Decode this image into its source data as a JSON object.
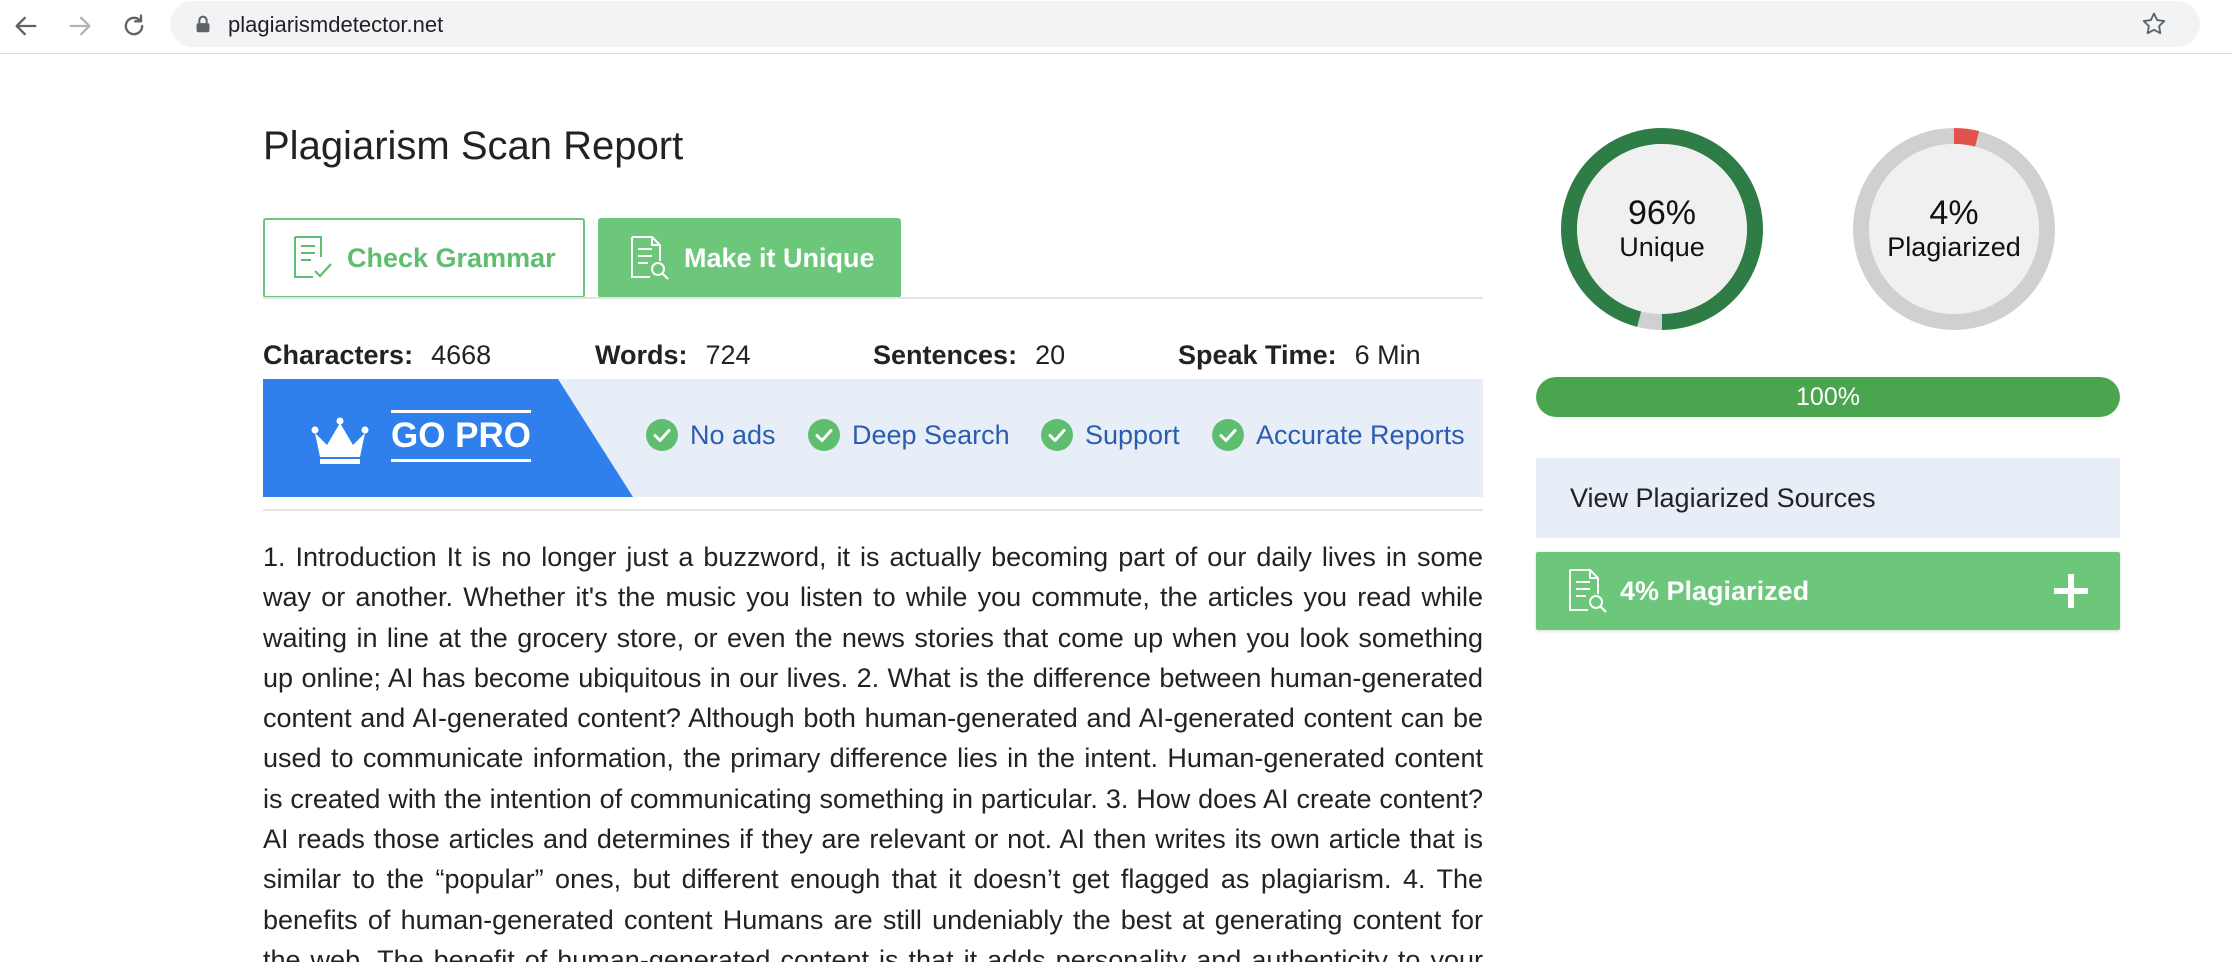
{
  "browser": {
    "url": "plagiarismdetector.net"
  },
  "page": {
    "title": "Plagiarism Scan Report",
    "buttons": {
      "check_grammar": "Check Grammar",
      "make_unique": "Make it Unique"
    },
    "stats": [
      {
        "label": "Characters:",
        "value": "4668"
      },
      {
        "label": "Words:",
        "value": "724"
      },
      {
        "label": "Sentences:",
        "value": "20"
      },
      {
        "label": "Speak Time:",
        "value": "6 Min"
      }
    ],
    "pro_banner": {
      "label": "GO PRO",
      "features": [
        "No ads",
        "Deep Search",
        "Support",
        "Accurate Reports"
      ]
    },
    "body_text": "1. Introduction It is no longer just a buzzword, it is actually becoming part of our daily lives in some way or another. Whether it's the music you listen to while you commute, the articles you read while waiting in line at the grocery store, or even the news stories that come up when you look something up online; AI has become ubiquitous in our lives. 2. What is the difference between human-generated content and AI-generated content? Although both human-generated and AI-generated content can be used to communicate information, the primary difference lies in the intent. Human-generated content is created with the intention of communicating something in particular. 3. How does AI create content? AI reads those articles and determines if they are relevant or not. AI then writes its own article that is similar to the “popular” ones, but different enough that it doesn’t get flagged as plagiarism. 4. The benefits of human-generated content Humans are still undeniably the best at generating content for the web. The benefit of human-generated content is that it adds personality and authenticity to your blog and"
  },
  "results": {
    "unique": {
      "percent_label": "96%",
      "caption": "Unique",
      "fraction": 0.96
    },
    "plagiarized": {
      "percent_label": "4%",
      "caption": "Plagiarized",
      "fraction": 0.04
    },
    "progress": {
      "label": "100%",
      "fraction": 1.0
    },
    "view_sources_label": "View Plagiarized Sources",
    "plagiarized_section_label": "4% Plagiarized"
  },
  "colors": {
    "green": "#6cc77b",
    "dark_green": "#2e7d46",
    "progress_green": "#4aa54f",
    "red": "#e0534b",
    "blue": "#2f80ed",
    "light_blue_bg": "#e8eef8",
    "feature_text": "#2a5db0",
    "ring_gray": "#d0d0d0"
  }
}
